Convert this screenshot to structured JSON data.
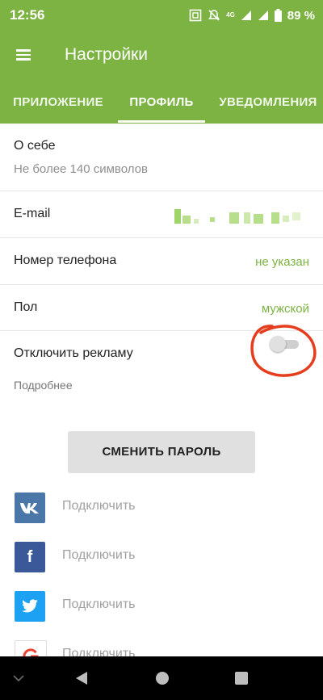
{
  "status_bar": {
    "time": "12:56",
    "network": "4G",
    "battery": "89 %"
  },
  "app_bar": {
    "title": "Настройки",
    "menu_icon": "hamburger-menu-icon"
  },
  "tabs": [
    {
      "label": "ПРИЛОЖЕНИЕ",
      "active": false
    },
    {
      "label": "ПРОФИЛЬ",
      "active": true
    },
    {
      "label": "УВЕДОМЛЕНИЯ",
      "active": false
    }
  ],
  "profile": {
    "about": {
      "label": "О себе",
      "placeholder": "Не более 140 символов"
    },
    "email": {
      "label": "E-mail"
    },
    "phone": {
      "label": "Номер телефона",
      "value": "не указан"
    },
    "gender": {
      "label": "Пол",
      "value": "мужской"
    },
    "ads": {
      "label": "Отключить рекламу",
      "more": "Подробнее",
      "enabled": false
    },
    "change_password": "СМЕНИТЬ ПАРОЛЬ",
    "social": [
      {
        "network": "vk",
        "label": "Подключить",
        "color": "#4a76a8"
      },
      {
        "network": "facebook",
        "label": "Подключить",
        "color": "#3b5998"
      },
      {
        "network": "twitter",
        "label": "Подключить",
        "color": "#1da1f2"
      },
      {
        "network": "google",
        "label": "Подключить",
        "color": "#ffffff"
      }
    ]
  },
  "colors": {
    "accent": "#7cb342",
    "annotation": "#e53e1e"
  }
}
